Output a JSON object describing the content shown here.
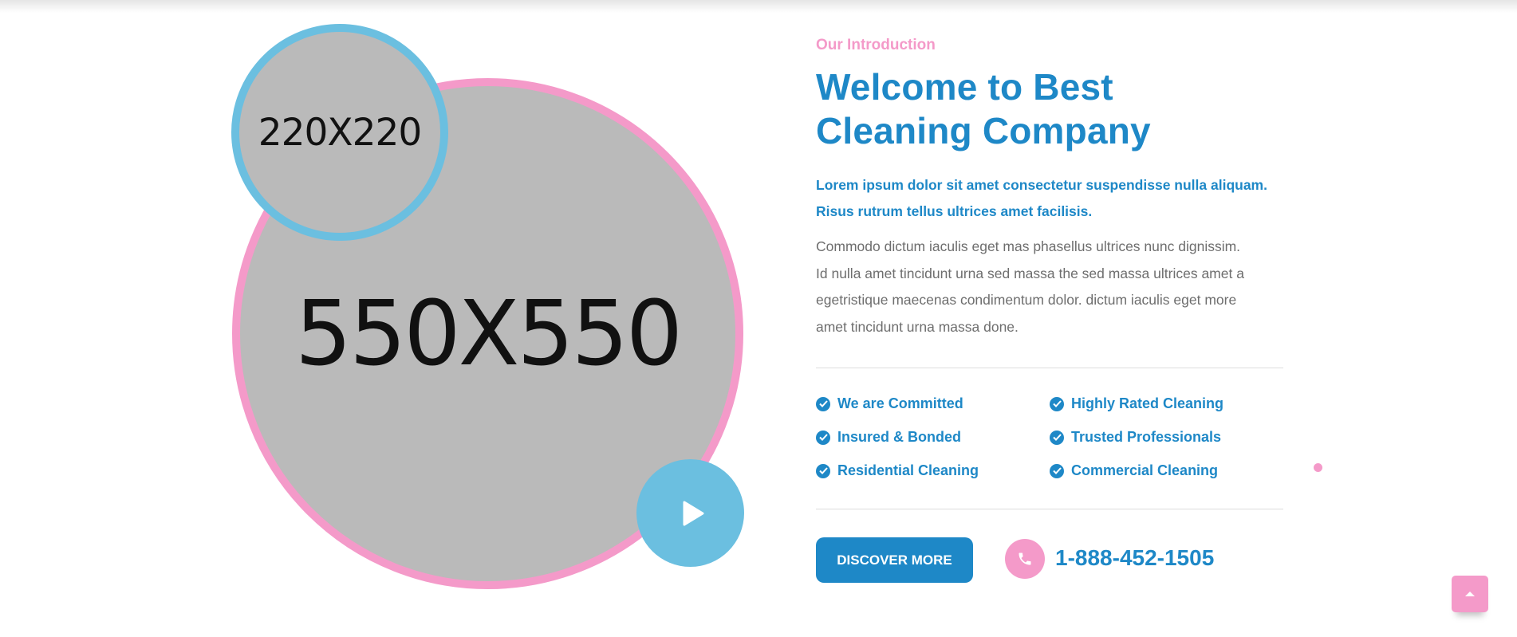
{
  "images": {
    "main_placeholder": "550X550",
    "secondary_placeholder": "220X220"
  },
  "intro": {
    "eyebrow": "Our Introduction",
    "title_line1": "Welcome to Best",
    "title_line2": "Cleaning Company",
    "lead_line1": "Lorem ipsum dolor sit amet consectetur suspendisse nulla aliquam.",
    "lead_line2": "Risus rutrum tellus ultrices amet facilisis.",
    "body_line1": "Commodo dictum iaculis eget mas phasellus ultrices nunc dignissim.",
    "body_line2": "Id nulla amet tincidunt urna sed massa the sed massa ultrices amet a",
    "body_line3": "egetristique maecenas condimentum dolor. dictum iaculis eget more",
    "body_line4": "amet tincidunt urna massa done."
  },
  "features": [
    {
      "label": "We are Committed",
      "icon": "check-circle-icon"
    },
    {
      "label": "Highly Rated Cleaning",
      "icon": "check-circle-icon"
    },
    {
      "label": "Insured & Bonded",
      "icon": "check-circle-icon"
    },
    {
      "label": "Trusted Professionals",
      "icon": "check-circle-icon"
    },
    {
      "label": "Residential Cleaning",
      "icon": "check-circle-icon"
    },
    {
      "label": "Commercial Cleaning",
      "icon": "check-circle-icon"
    }
  ],
  "cta": {
    "button_label": "DISCOVER MORE",
    "phone": "1-888-452-1505"
  },
  "colors": {
    "primary_blue": "#1e88c7",
    "pink": "#f49ac9",
    "light_blue": "#6bbfe0",
    "body_gray": "#6e6e6e",
    "placeholder_gray": "#bababa"
  }
}
